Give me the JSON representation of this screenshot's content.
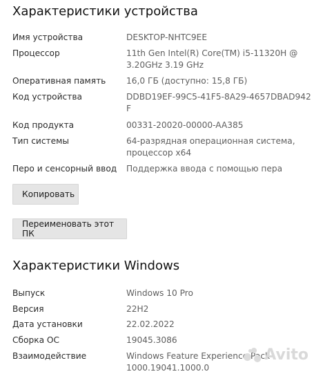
{
  "device_section": {
    "title": "Характеристики устройства",
    "rows": [
      {
        "label": "Имя устройства",
        "value": "DESKTOP-NHTC9EE"
      },
      {
        "label": "Процессор",
        "value": "11th Gen Intel(R) Core(TM) i5-11320H @\n3.20GHz   3.19 GHz"
      },
      {
        "label": "Оперативная память",
        "value": "16,0 ГБ (доступно: 15,8 ГБ)"
      },
      {
        "label": "Код устройства",
        "value": "DDBD19EF-99C5-41F5-8A29-4657DBAD942\nF"
      },
      {
        "label": "Код продукта",
        "value": "00331-20020-00000-AA385"
      },
      {
        "label": "Тип системы",
        "value": "64-разрядная операционная система,\nпроцессор x64"
      },
      {
        "label": "Перо и сенсорный ввод",
        "value": "Поддержка ввода с помощью пера"
      }
    ],
    "copy_button": "Копировать",
    "rename_button": "Переименовать этот ПК"
  },
  "windows_section": {
    "title": "Характеристики Windows",
    "rows": [
      {
        "label": "Выпуск",
        "value": "Windows 10 Pro"
      },
      {
        "label": "Версия",
        "value": "22H2"
      },
      {
        "label": "Дата установки",
        "value": "22.02.2022"
      },
      {
        "label": "Сборка ОС",
        "value": "19045.3086"
      },
      {
        "label": "Взаимодействие",
        "value": "Windows Feature Experience Pack\n1000.19041.1000.0"
      }
    ]
  },
  "watermark": {
    "text": "Avito"
  }
}
